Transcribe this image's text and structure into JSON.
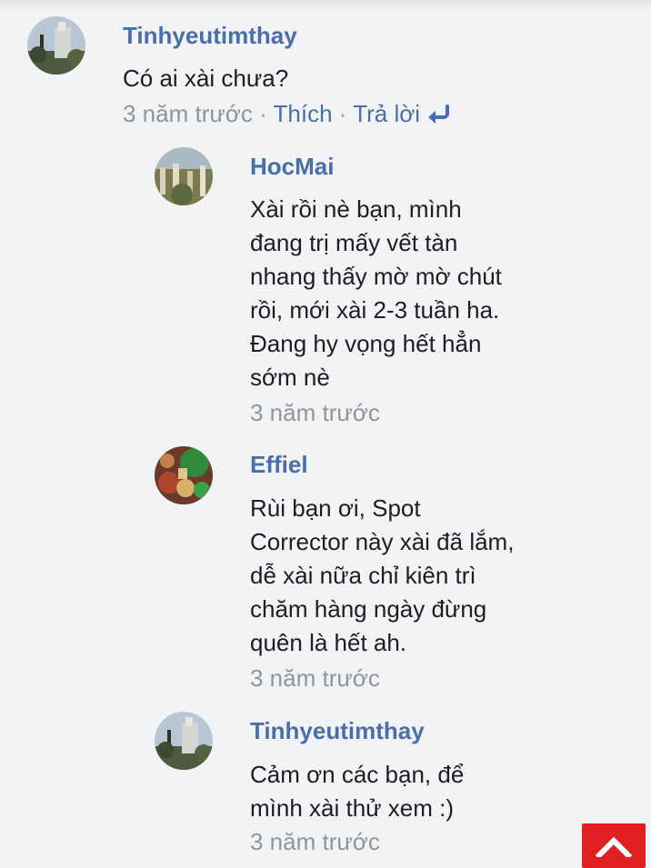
{
  "comment": {
    "author": "Tinhyeutimthay",
    "text": "Có ai xài chưa?",
    "time": "3 năm trước",
    "separator": "·",
    "like_label": "Thích",
    "reply_label": "Trả lời",
    "reply_icon": "reply-arrow-icon"
  },
  "replies": [
    {
      "author": "HocMai",
      "lines": [
        "Xài rồi nè bạn, mình",
        "đang trị mấy vết tàn",
        "nhang thấy mờ mờ chút",
        "rồi, mới xài 2-3 tuần ha.",
        "Đang hy vọng hết hẳn",
        "sớm nè"
      ],
      "time": "3 năm trước"
    },
    {
      "author": "Effiel",
      "lines": [
        "Rùi bạn ơi, Spot",
        "Corrector này xài đã lắm,",
        "dễ xài nữa chỉ kiên trì",
        "chăm hàng ngày đừng",
        "quên là hết ah."
      ],
      "time": "3 năm trước"
    },
    {
      "author": "Tinhyeutimthay",
      "lines": [
        "Cảm ơn các bạn, để",
        "mình xài thử xem :)"
      ],
      "time": "3 năm trước"
    }
  ],
  "scroll_top_icon": "chevron-up-icon",
  "colors": {
    "accent": "#4a6ea9",
    "muted": "#90949c",
    "scroll_button": "#e02020"
  }
}
